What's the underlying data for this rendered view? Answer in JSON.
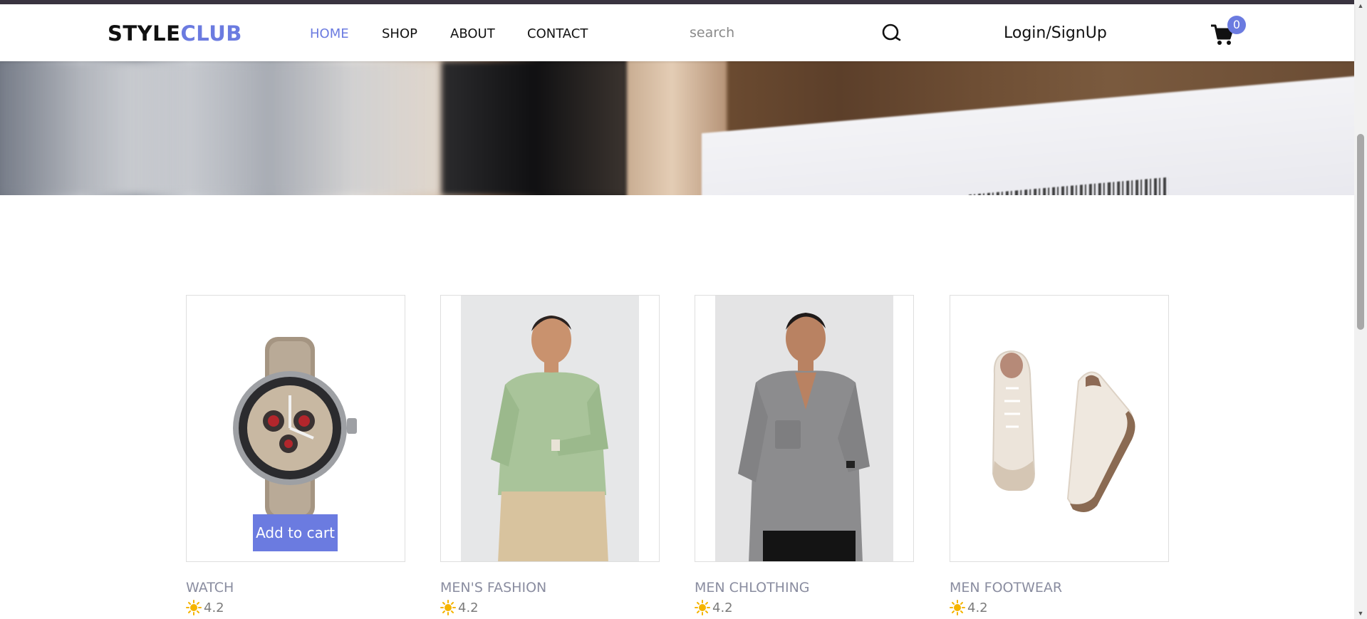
{
  "brand": {
    "part1": "STYLE",
    "part2": "CLUB",
    "accent_color": "#6b7be0"
  },
  "nav": [
    {
      "label": "HOME",
      "active": true
    },
    {
      "label": "SHOP",
      "active": false
    },
    {
      "label": "ABOUT",
      "active": false
    },
    {
      "label": "CONTACT",
      "active": false
    }
  ],
  "search": {
    "placeholder": "search",
    "value": "",
    "icon": "search-icon"
  },
  "auth": {
    "label": "Login/SignUp"
  },
  "cart": {
    "count": "0",
    "icon": "cart-icon"
  },
  "products": [
    {
      "name": "WATCH",
      "rating": "4.2",
      "rating_icon": "sun-icon",
      "cta": "Add to cart"
    },
    {
      "name": "MEN'S FASHION",
      "rating": "4.2",
      "rating_icon": "sun-icon"
    },
    {
      "name": "MEN CHLOTHING",
      "rating": "4.2",
      "rating_icon": "sun-icon"
    },
    {
      "name": "MEN FOOTWEAR",
      "rating": "4.2",
      "rating_icon": "sun-icon"
    }
  ]
}
